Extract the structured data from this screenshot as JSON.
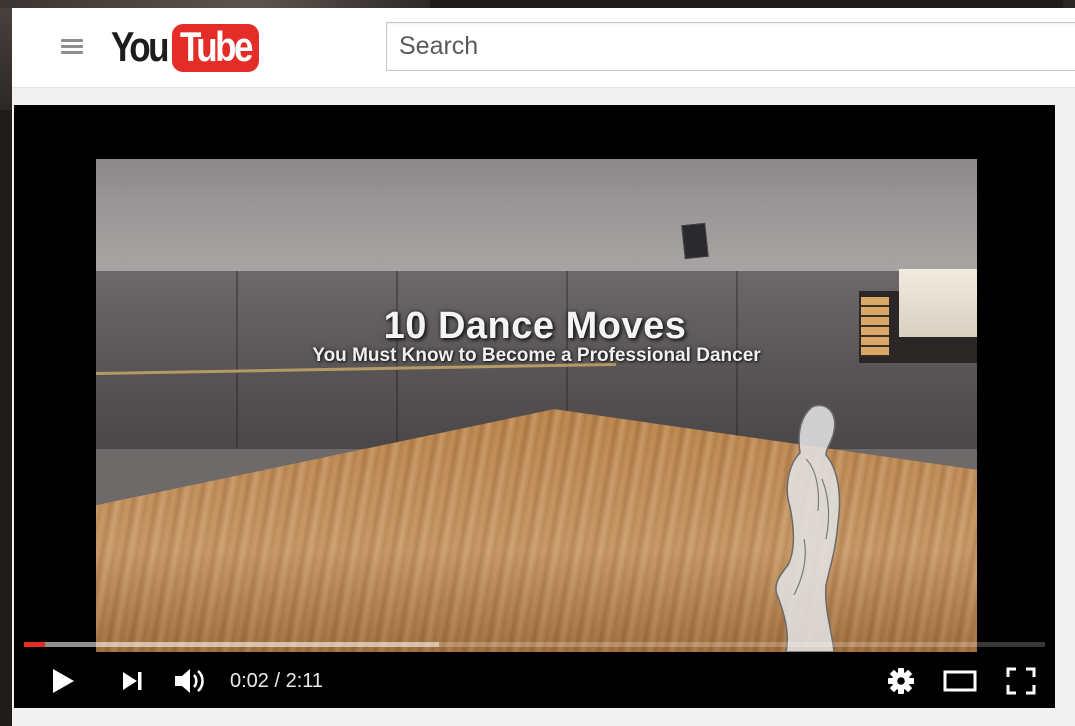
{
  "header": {
    "logo_you": "You",
    "logo_tube": "Tube",
    "search_placeholder": "Search"
  },
  "video": {
    "title": "10 Dance Moves",
    "subtitle": "You Must Know to Become a Professional Dancer"
  },
  "player": {
    "current_time": "0:02",
    "duration": "2:11",
    "time_display": "0:02 / 2:11",
    "played_fraction": 0.021,
    "buffered_fraction": 0.406
  },
  "colors": {
    "brand_red": "#e52d27",
    "player_bg": "#000000"
  },
  "icons": [
    "menu-icon",
    "play-icon",
    "next-icon",
    "volume-icon",
    "settings-icon",
    "theater-mode-icon",
    "fullscreen-icon"
  ]
}
